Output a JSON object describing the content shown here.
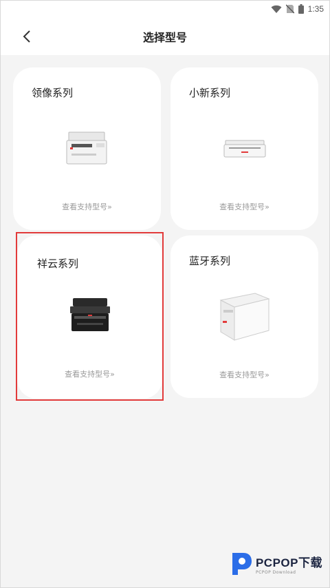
{
  "status_bar": {
    "time": "1:35"
  },
  "header": {
    "title": "选择型号"
  },
  "cards": [
    {
      "title": "领像系列",
      "link": "查看支持型号»",
      "image": "printer-mfp-icon"
    },
    {
      "title": "小新系列",
      "link": "查看支持型号»",
      "image": "printer-compact-icon"
    },
    {
      "title": "祥云系列",
      "link": "查看支持型号»",
      "image": "printer-black-mfp-icon"
    },
    {
      "title": "蓝牙系列",
      "link": "查看支持型号»",
      "image": "printer-white-mfp-icon"
    }
  ],
  "watermark": {
    "brand": "PCPOP下载",
    "sub": "PCPOP Download"
  },
  "colors": {
    "highlight": "#e23a3a",
    "accent_red": "#e23a3a"
  }
}
